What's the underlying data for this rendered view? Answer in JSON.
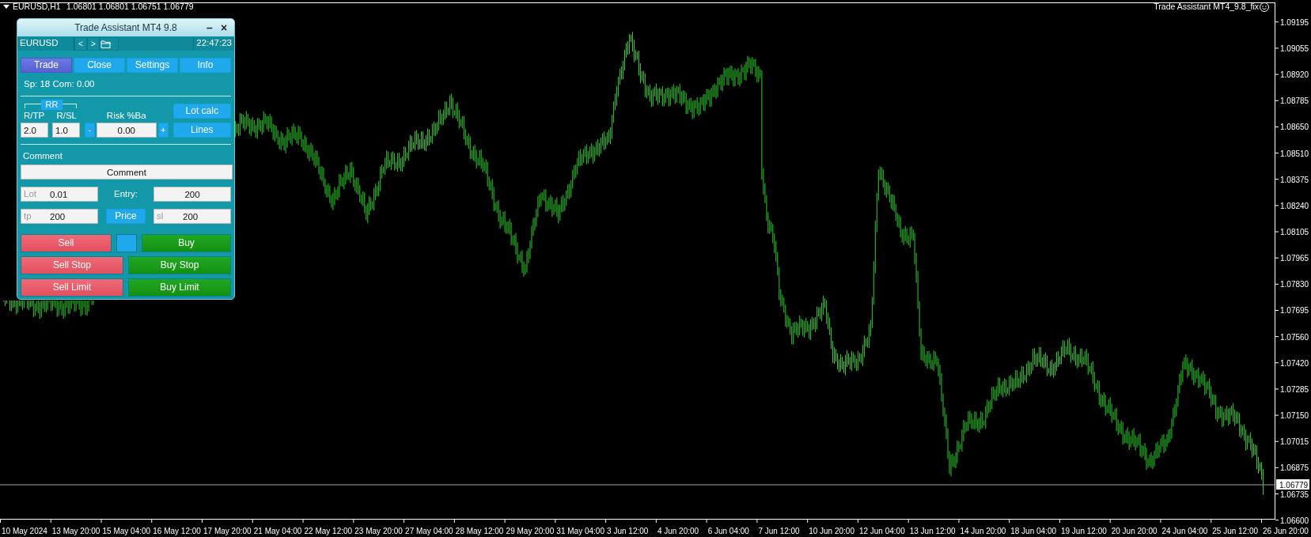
{
  "chart_header": {
    "symbol": "EURUSD,H1",
    "quote": "1.06801 1.06801 1.06751 1.06779",
    "expert": "Trade Assistant MT4_9.8_fix"
  },
  "chart": {
    "price_axis": {
      "labels": [
        "1.09195",
        "1.09055",
        "1.08920",
        "1.08785",
        "1.08650",
        "1.08510",
        "1.08375",
        "1.08240",
        "1.08105",
        "1.07965",
        "1.07830",
        "1.07695",
        "1.07560",
        "1.07420",
        "1.07285",
        "1.07150",
        "1.07015",
        "1.06875",
        "1.06735",
        "1.06600"
      ],
      "current_price": "1.06779"
    },
    "time_axis": {
      "labels": [
        "10 May 2024",
        "13 May 20:00",
        "15 May 04:00",
        "16 May 12:00",
        "17 May 20:00",
        "21 May 04:00",
        "22 May 12:00",
        "23 May 20:00",
        "27 May 04:00",
        "28 May 12:00",
        "29 May 20:00",
        "31 May 04:00",
        "3 Jun 12:00",
        "4 Jun 20:00",
        "6 Jun 04:00",
        "7 Jun 12:00",
        "10 Jun 20:00",
        "12 Jun 04:00",
        "13 Jun 12:00",
        "14 Jun 20:00",
        "18 Jun 04:00",
        "19 Jun 12:00",
        "20 Jun 20:00",
        "24 Jun 04:00",
        "25 Jun 12:00",
        "26 Jun 20:00"
      ]
    }
  },
  "panel": {
    "title": "Trade Assistant MT4 9.8",
    "minimize": "–",
    "close": "×",
    "symbol": "EURUSD",
    "nav": [
      "<",
      ">"
    ],
    "time": "22:47:23",
    "tabs": [
      {
        "label": "Trade",
        "selected": true
      },
      {
        "label": "Close",
        "selected": false
      },
      {
        "label": "Settings",
        "selected": false
      },
      {
        "label": "Info",
        "selected": false
      }
    ],
    "info": "Sp: 18  Com: 0.00",
    "rr": {
      "label": "RR",
      "tp_label": "R/TP",
      "sl_label": "R/SL",
      "tp": "2.0",
      "sl": "1.0"
    },
    "risk": {
      "label": "Risk %Ba",
      "minus": "-",
      "value": "0.00",
      "plus": "+"
    },
    "lot_calc": "Lot calc",
    "lines": "Lines",
    "comment": {
      "label": "Comment",
      "value": "Comment"
    },
    "lot": {
      "label": "Lot",
      "value": "0.01"
    },
    "entry": {
      "label": "Entry:",
      "value": "200"
    },
    "tp": {
      "label": "tp",
      "value": "200"
    },
    "price": "Price",
    "sl": {
      "label": "sl",
      "value": "200"
    },
    "order_rows": [
      [
        {
          "kind": "sell",
          "label": "Sell"
        },
        {
          "kind": "blank"
        },
        {
          "kind": "buy",
          "label": "Buy"
        }
      ],
      [
        {
          "kind": "sell",
          "label": "Sell Stop"
        },
        {
          "kind": "buy",
          "label": "Buy Stop"
        }
      ],
      [
        {
          "kind": "sell",
          "label": "Sell Limit"
        },
        {
          "kind": "buy",
          "label": "Buy Limit"
        }
      ]
    ]
  }
}
